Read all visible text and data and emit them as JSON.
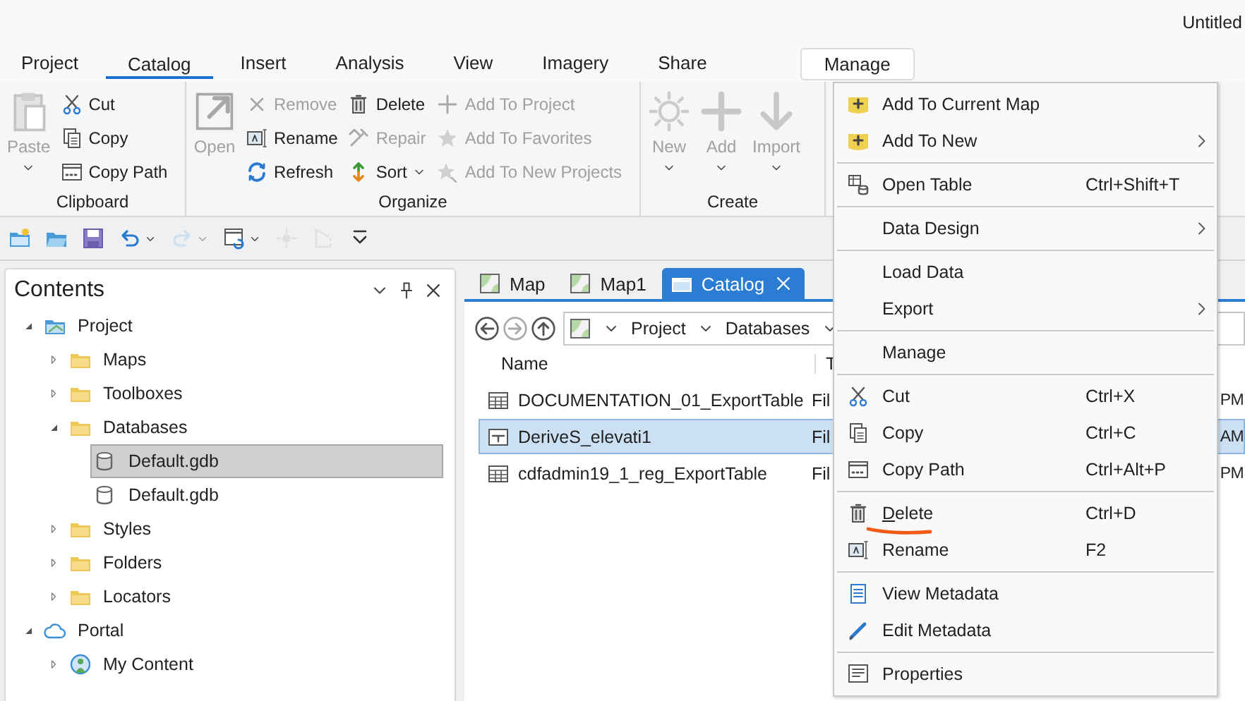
{
  "title": "Untitled",
  "ribbon_tabs": [
    {
      "label": "Project",
      "selected": false,
      "contextual": false
    },
    {
      "label": "Catalog",
      "selected": true,
      "contextual": false
    },
    {
      "label": "Insert",
      "selected": false,
      "contextual": false
    },
    {
      "label": "Analysis",
      "selected": false,
      "contextual": false
    },
    {
      "label": "View",
      "selected": false,
      "contextual": false
    },
    {
      "label": "Imagery",
      "selected": false,
      "contextual": false
    },
    {
      "label": "Share",
      "selected": false,
      "contextual": false
    },
    {
      "label": "Manage",
      "selected": false,
      "contextual": true
    }
  ],
  "ribbon_groups": [
    {
      "label": "Clipboard",
      "large": [
        {
          "label": "Paste",
          "disabled": true,
          "dropdown": true
        }
      ],
      "columns": [
        [
          {
            "label": "Cut",
            "disabled": false,
            "dropdown": false
          },
          {
            "label": "Copy",
            "disabled": false,
            "dropdown": false
          },
          {
            "label": "Copy Path",
            "disabled": false,
            "dropdown": false
          }
        ]
      ]
    },
    {
      "label": "Organize",
      "large": [
        {
          "label": "Open",
          "disabled": true,
          "dropdown": false
        }
      ],
      "columns": [
        [
          {
            "label": "Remove",
            "disabled": true,
            "dropdown": false
          },
          {
            "label": "Rename",
            "disabled": false,
            "dropdown": false
          },
          {
            "label": "Refresh",
            "disabled": false,
            "dropdown": false
          }
        ],
        [
          {
            "label": "Delete",
            "disabled": false,
            "dropdown": false
          },
          {
            "label": "Repair",
            "disabled": true,
            "dropdown": false
          },
          {
            "label": "Sort",
            "disabled": false,
            "dropdown": true
          }
        ],
        [
          {
            "label": "Add To Project",
            "disabled": true,
            "dropdown": false
          },
          {
            "label": "Add To Favorites",
            "disabled": true,
            "dropdown": false
          },
          {
            "label": "Add To New Projects",
            "disabled": true,
            "dropdown": false
          }
        ]
      ]
    },
    {
      "label": "Create",
      "large": [
        {
          "label": "New",
          "disabled": true,
          "dropdown": true
        },
        {
          "label": "Add",
          "disabled": true,
          "dropdown": true
        },
        {
          "label": "Import",
          "disabled": true,
          "dropdown": true
        }
      ]
    }
  ],
  "quick_access": [
    {
      "disabled": false,
      "dropdown": false
    },
    {
      "disabled": false,
      "dropdown": false
    },
    {
      "disabled": false,
      "dropdown": false
    },
    {
      "disabled": false,
      "dropdown": true
    },
    {
      "disabled": true,
      "dropdown": true
    },
    {
      "disabled": false,
      "dropdown": true
    },
    {
      "disabled": true,
      "dropdown": false
    },
    {
      "disabled": true,
      "dropdown": false
    },
    {
      "disabled": false,
      "dropdown": false
    }
  ],
  "contents": {
    "title": "Contents",
    "tree": [
      {
        "label": "Project",
        "kind": "project",
        "expanded": true,
        "selected": false,
        "children": [
          {
            "label": "Maps",
            "kind": "folder",
            "expanded": false,
            "selected": false
          },
          {
            "label": "Toolboxes",
            "kind": "folder",
            "expanded": false,
            "selected": false
          },
          {
            "label": "Databases",
            "kind": "folder",
            "expanded": true,
            "selected": false,
            "children": [
              {
                "label": "Default.gdb",
                "kind": "gdb",
                "selected": true
              },
              {
                "label": "Default.gdb",
                "kind": "gdb",
                "selected": false
              }
            ]
          },
          {
            "label": "Styles",
            "kind": "folder",
            "expanded": false,
            "selected": false
          },
          {
            "label": "Folders",
            "kind": "folder",
            "expanded": false,
            "selected": false
          },
          {
            "label": "Locators",
            "kind": "folder",
            "expanded": false,
            "selected": false
          }
        ]
      },
      {
        "label": "Portal",
        "kind": "portal",
        "expanded": true,
        "selected": false,
        "children": [
          {
            "label": "My Content",
            "kind": "portal_item",
            "expanded": false,
            "selected": false
          }
        ]
      }
    ]
  },
  "view_tabs": [
    {
      "label": "Map",
      "kind": "map",
      "selected": false
    },
    {
      "label": "Map1",
      "kind": "map",
      "selected": false
    },
    {
      "label": "Catalog",
      "kind": "catalog",
      "selected": true
    }
  ],
  "breadcrumb": [
    "Project",
    "Databases"
  ],
  "file_list": {
    "columns": [
      "Name",
      "T"
    ],
    "rows": [
      {
        "name": "DOCUMENTATION_01_ExportTable",
        "kind": "table",
        "column_2": "Fil",
        "column_3": "PM",
        "selected": false
      },
      {
        "name": "DeriveS_elevati1",
        "kind": "feature",
        "column_2": "Fil",
        "column_3": "AM",
        "selected": true
      },
      {
        "name": "cdfadmin19_1_reg_ExportTable",
        "kind": "table",
        "column_2": "Fil",
        "column_3": "PM",
        "selected": false
      }
    ]
  },
  "context_menu": {
    "groups": [
      [
        {
          "label": "Add To Current Map",
          "submenu": false,
          "mnemonic_shown": false
        },
        {
          "label": "Add To New",
          "submenu": true,
          "mnemonic_shown": false
        }
      ],
      [
        {
          "label": "Open Table",
          "shortcut": "Ctrl+Shift+T",
          "submenu": false,
          "mnemonic_shown": false
        }
      ],
      [
        {
          "label": "Data Design",
          "submenu": true,
          "mnemonic_shown": false
        }
      ],
      [
        {
          "label": "Load Data",
          "submenu": false,
          "mnemonic_shown": false
        },
        {
          "label": "Export",
          "submenu": true,
          "mnemonic_shown": false
        }
      ],
      [
        {
          "label": "Manage",
          "submenu": false,
          "mnemonic_shown": false
        }
      ],
      [
        {
          "label": "Cut",
          "shortcut": "Ctrl+X",
          "submenu": false,
          "mnemonic_shown": false
        },
        {
          "label": "Copy",
          "shortcut": "Ctrl+C",
          "submenu": false,
          "mnemonic_shown": false
        },
        {
          "label": "Copy Path",
          "shortcut": "Ctrl+Alt+P",
          "submenu": false,
          "mnemonic_shown": false
        }
      ],
      [
        {
          "label": "Delete",
          "shortcut": "Ctrl+D",
          "submenu": false,
          "mnemonic_shown": true
        },
        {
          "label": "Rename",
          "shortcut": "F2",
          "submenu": false,
          "mnemonic_shown": false
        }
      ],
      [
        {
          "label": "View Metadata",
          "submenu": false,
          "mnemonic_shown": false
        },
        {
          "label": "Edit Metadata",
          "submenu": false,
          "mnemonic_shown": false
        }
      ],
      [
        {
          "label": "Properties",
          "submenu": false,
          "mnemonic_shown": false
        }
      ]
    ]
  }
}
